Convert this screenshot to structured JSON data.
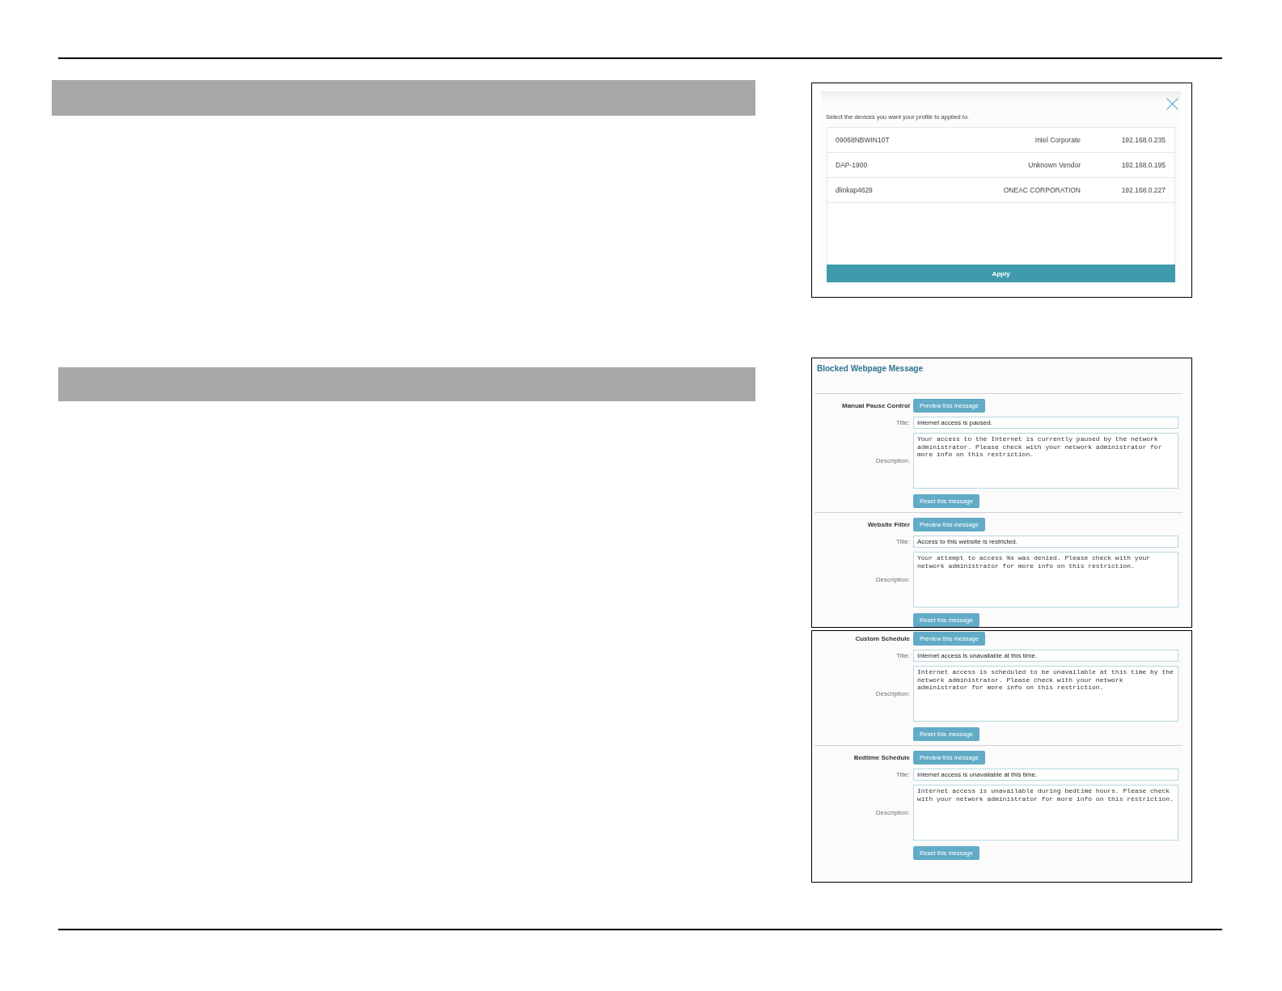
{
  "screenshots": [
    {
      "kind": "device_dialog",
      "prompt": "Select the devices you want your profile to applied to.",
      "devices": [
        {
          "name": "09068NBWIN10T",
          "vendor": "Intel Corporate",
          "ip": "192.168.0.235"
        },
        {
          "name": "DAP-1900",
          "vendor": "Unknown Vendor",
          "ip": "192.168.0.195"
        },
        {
          "name": "dlinkap4629",
          "vendor": "ONEAC CORPORATION",
          "ip": "192.168.0.227"
        }
      ],
      "apply_button": "Apply"
    },
    {
      "kind": "message_settings",
      "heading": "Blocked Webpage Message",
      "sections": [
        {
          "category": "Manual Pause Control",
          "preview_button": "Preview this message",
          "title_label": "Title:",
          "title_value": "Internet access is paused.",
          "description_label": "Description:",
          "description_value": "Your access to the Internet is currently paused by the network administrator. Please check with your network administrator for more info on this restriction.",
          "reset_button": "Reset this message"
        },
        {
          "category": "Website Filter",
          "preview_button": "Preview this message",
          "title_label": "Title:",
          "title_value": "Access to this website is restricted.",
          "description_label": "Description:",
          "description_value": "Your attempt to access %s was denied. Please check with your network administrator for more info on this restriction.",
          "reset_button": "Reset this message"
        }
      ]
    },
    {
      "kind": "message_settings",
      "sections": [
        {
          "category": "Custom Schedule",
          "preview_button": "Preview this message",
          "title_label": "Title:",
          "title_value": "Internet access is unavailable at this time.",
          "description_label": "Description:",
          "description_value": "Internet access is scheduled to be unavailable at this time by the network administrator. Please check with your network administrator for more info on this restriction.",
          "reset_button": "Reset this message"
        },
        {
          "category": "Bedtime Schedule",
          "preview_button": "Preview this message",
          "title_label": "Title:",
          "title_value": "Internet access is unavailable at this time.",
          "description_label": "Description:",
          "description_value": "Internet access is unavailable during bedtime hours. Please check with your network administrator for more info on this restriction.",
          "reset_button": "Reset this message"
        }
      ]
    }
  ]
}
